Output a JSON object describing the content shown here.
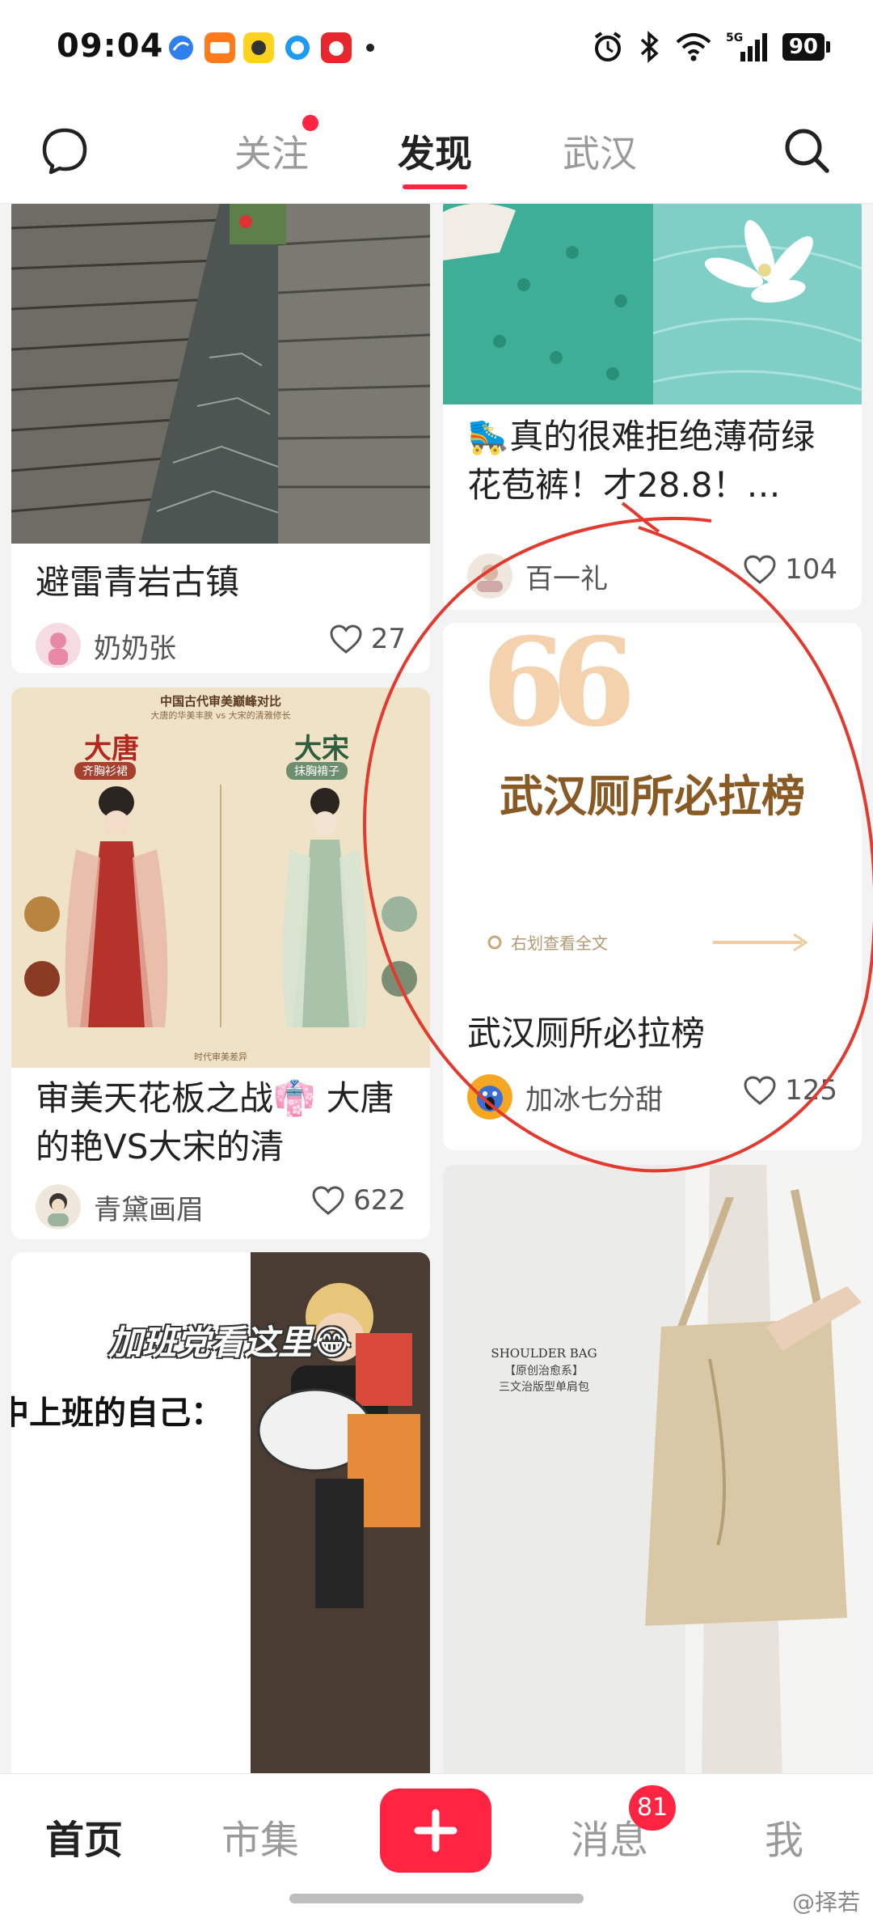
{
  "status_bar": {
    "time": "09:04",
    "app_icons": [
      "taobao-flash-icon",
      "eleme-icon",
      "app-icon-yellow",
      "qq-browser-icon",
      "pinduoduo-icon"
    ],
    "network": "5G",
    "battery": "90"
  },
  "top_nav": {
    "tabs": [
      "关注",
      "发现",
      "武汉"
    ],
    "active_tab": "发现",
    "accent": "#ff2442"
  },
  "feed": {
    "cards": [
      {
        "title": "避雷青岩古镇",
        "author": "奶奶张",
        "likes": "27"
      },
      {
        "title": "🛼真的很难拒绝薄荷绿花苞裤！才28.8！…",
        "author": "百一礼",
        "likes": "104"
      },
      {
        "cover_quote": "66",
        "cover_title": "武汉厕所必拉榜",
        "cover_hint": "右划查看全文",
        "title": "武汉厕所必拉榜",
        "author": "加冰七分甜",
        "likes": "125"
      },
      {
        "title": "审美天花板之战👘 大唐的艳VS大宋的清",
        "author": "青黛画眉",
        "likes": "622",
        "cover_header": "中国古代审美巅峰对比",
        "cover_sub": "大唐的华美丰腴 vs 大宋的清雅修长",
        "left_dynasty": "大唐",
        "left_garment": "齐胸衫裙",
        "right_dynasty": "大宋",
        "right_garment": "抹胸褙子",
        "cover_footer": "时代审美差异"
      },
      {
        "cover_text": "中上班的自己：",
        "cover_caption": "加班党看这里😂"
      },
      {
        "cover_text1": "SHOULDER BAG",
        "cover_text2": "【原创治愈系】",
        "cover_text3": "三文治版型单肩包"
      }
    ]
  },
  "bottom_nav": {
    "items": [
      "首页",
      "市集",
      "消息",
      "我"
    ],
    "active": "首页",
    "message_badge": "81"
  },
  "watermark": "@择若"
}
